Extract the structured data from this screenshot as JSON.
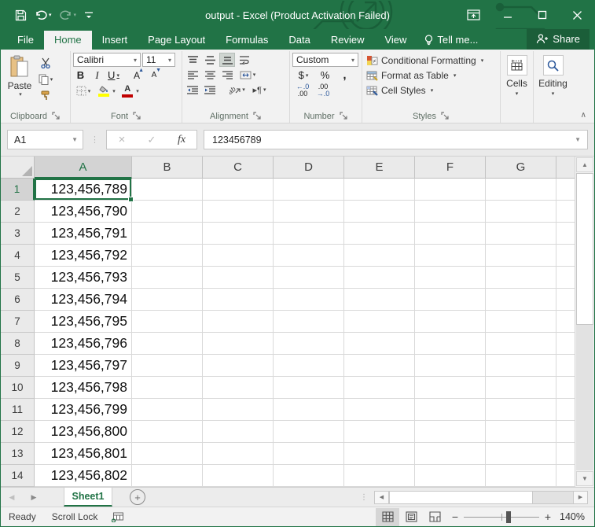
{
  "colors": {
    "excel_green": "#217346",
    "ribbon_bg": "#f2f2f2",
    "selected_header_bg": "#d3d3d3",
    "gridline": "#d9d9d9",
    "fill_color_swatch": "#ffff00",
    "font_color_swatch": "#c00000"
  },
  "titlebar": {
    "title": "output - Excel (Product Activation Failed)"
  },
  "tabs": {
    "file": "File",
    "home": "Home",
    "insert": "Insert",
    "page_layout": "Page Layout",
    "formulas": "Formulas",
    "data": "Data",
    "review": "Review",
    "view": "View",
    "tell_me": "Tell me...",
    "share": "Share"
  },
  "ribbon": {
    "clipboard": {
      "paste": "Paste",
      "label": "Clipboard"
    },
    "font": {
      "font_name": "Calibri",
      "font_size": "11",
      "bold": "B",
      "italic": "I",
      "underline": "U",
      "grow_font": "A",
      "shrink_font": "A",
      "font_color_letter": "A",
      "label": "Font"
    },
    "alignment": {
      "label": "Alignment",
      "orientation": "ab",
      "pilcrow": "¶"
    },
    "number": {
      "format": "Custom",
      "currency": "$",
      "percent": "%",
      "comma": ",",
      "inc_decimal_top": "←.0",
      "inc_decimal_bot": ".00",
      "dec_decimal_top": ".00",
      "dec_decimal_bot": "→.0",
      "label": "Number"
    },
    "styles": {
      "conditional_formatting": "Conditional Formatting",
      "format_as_table": "Format as Table",
      "cell_styles": "Cell Styles",
      "label": "Styles"
    },
    "cells": {
      "label": "Cells"
    },
    "editing": {
      "label": "Editing"
    }
  },
  "formula_bar": {
    "name_box": "A1",
    "cancel": "×",
    "enter": "✓",
    "fx": "fx",
    "value": "123456789"
  },
  "grid": {
    "columns": [
      "A",
      "B",
      "C",
      "D",
      "E",
      "F",
      "G"
    ],
    "selected_column": "A",
    "selected_cell": "A1",
    "row_numbers": [
      "1",
      "2",
      "3",
      "4",
      "5",
      "6",
      "7",
      "8",
      "9",
      "10",
      "11",
      "12",
      "13",
      "14"
    ],
    "values": [
      "123,456,789",
      "123,456,790",
      "123,456,791",
      "123,456,792",
      "123,456,793",
      "123,456,794",
      "123,456,795",
      "123,456,796",
      "123,456,797",
      "123,456,798",
      "123,456,799",
      "123,456,800",
      "123,456,801",
      "123,456,802"
    ]
  },
  "sheet_bar": {
    "active_tab": "Sheet1",
    "add_sheet": "+",
    "nav_left": "◀",
    "nav_right": "▶",
    "resize_dots": "⋮"
  },
  "status_bar": {
    "mode": "Ready",
    "scroll_lock": "Scroll Lock",
    "zoom_out": "−",
    "zoom_in": "+",
    "zoom_level": "140%"
  },
  "icons": {
    "undo_dd": "▾",
    "redo_dd": "▾",
    "scroll_up": "▲",
    "scroll_down": "▼",
    "scroll_left": "◀",
    "scroll_right": "▶",
    "collapse_ribbon": "∧"
  }
}
